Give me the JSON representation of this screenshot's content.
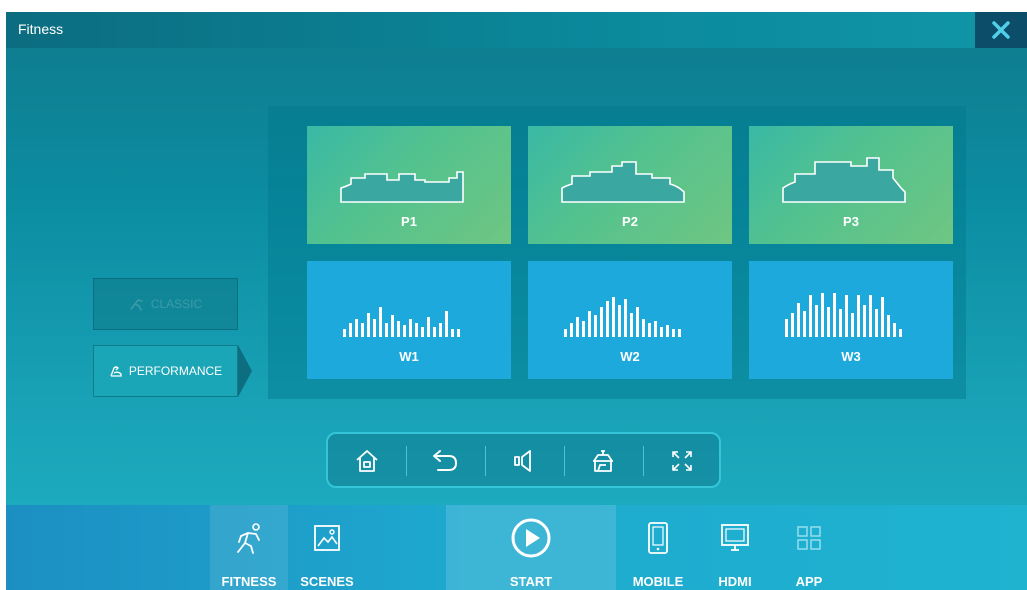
{
  "window": {
    "title": "Fitness"
  },
  "modes": {
    "classic_label": "CLASSIC",
    "performance_label": "PERFORMANCE",
    "selected": "PERFORMANCE"
  },
  "programs": [
    {
      "label": "P1",
      "kind": "profile"
    },
    {
      "label": "P2",
      "kind": "profile"
    },
    {
      "label": "P3",
      "kind": "profile"
    },
    {
      "label": "W1",
      "kind": "bars"
    },
    {
      "label": "W2",
      "kind": "bars"
    },
    {
      "label": "W3",
      "kind": "bars"
    }
  ],
  "toolbar": [
    {
      "icon": "home-icon"
    },
    {
      "icon": "back-icon"
    },
    {
      "icon": "volume-icon"
    },
    {
      "icon": "lamp-icon"
    },
    {
      "icon": "fullscreen-icon"
    }
  ],
  "bottom_nav": {
    "fitness_label": "FITNESS",
    "scenes_label": "SCENES",
    "start_label": "START",
    "mobile_label": "MOBILE",
    "hdmi_label": "HDMI",
    "app_label": "APP"
  },
  "colors": {
    "accent": "#1aa6b6",
    "profile_tile": "#54c28e",
    "bars_tile": "#1da9dc",
    "close_bg": "#0c4e6a"
  }
}
